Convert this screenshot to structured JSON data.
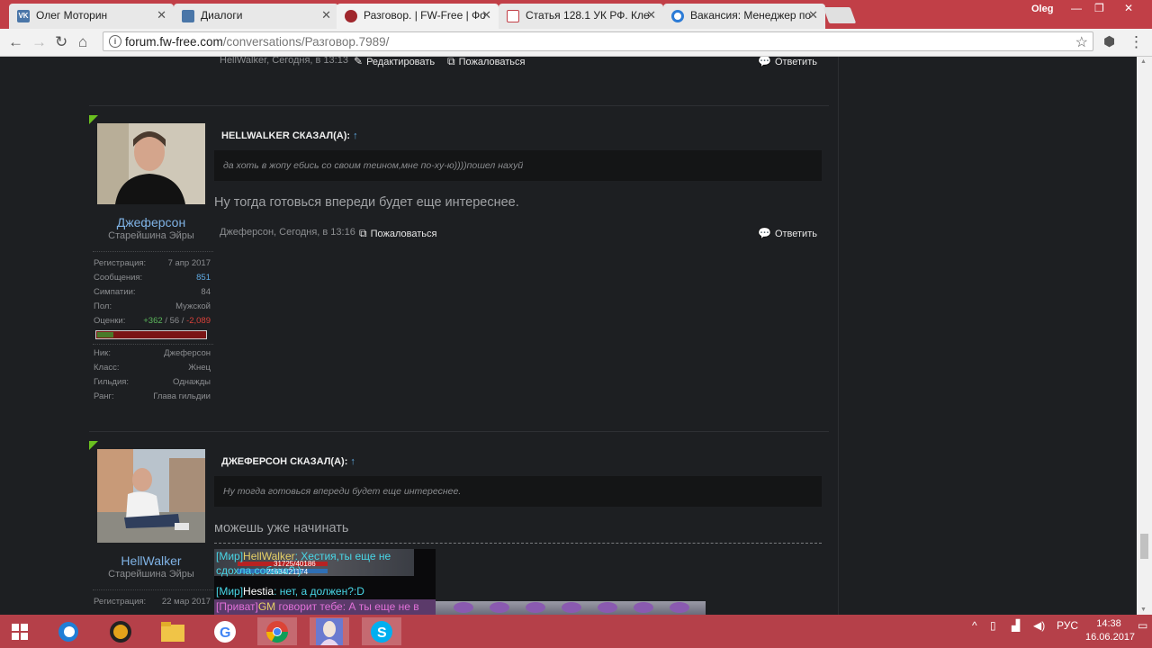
{
  "browser": {
    "tabs": [
      {
        "title": "Олег Моторин",
        "icon": "vk-icon",
        "color": "#4a76a8"
      },
      {
        "title": "Диалоги",
        "icon": "chat-icon",
        "color": "#4a76a8"
      },
      {
        "title": "Разговор. | FW-Free | Фо",
        "icon": "fwfree-icon",
        "color": "#a0272d",
        "active": true
      },
      {
        "title": "Статья 128.1 УК РФ. Кле",
        "icon": "doc-icon",
        "color": "#c13f47"
      },
      {
        "title": "Вакансия: Менеджер по",
        "icon": "hh-icon",
        "color": "#2c7bd6"
      }
    ],
    "user": "Oleg",
    "url_host": "forum.fw-free.com",
    "url_path": "/conversations/Разговор.7989/"
  },
  "posts": [
    {
      "meta": "HellWalker, Сегодня, в 13:13",
      "edit_label": "Редактировать",
      "report_label": "Пожаловаться",
      "reply_label": "Ответить"
    },
    {
      "username": "Джеферсон",
      "usertitle": "Старейшина Эйры",
      "stats": [
        {
          "label": "Регистрация:",
          "value": "7 апр 2017"
        },
        {
          "label": "Сообщения:",
          "value": "851"
        },
        {
          "label": "Симпатии:",
          "value": "84"
        },
        {
          "label": "Пол:",
          "value": "Мужской"
        }
      ],
      "ratings_label": "Оценки:",
      "ratings": {
        "positive": "+362",
        "sep1": " / ",
        "neutral": "56",
        "sep2": " / ",
        "negative": "-2,089"
      },
      "rating_bar_positive_fraction": 0.15,
      "game_stats": [
        {
          "label": "Ник:",
          "value": "Джеферсон"
        },
        {
          "label": "Класс:",
          "value": "Жнец"
        },
        {
          "label": "Гильдия:",
          "value": "Однажды"
        },
        {
          "label": "Ранг:",
          "value": "Глава гильдии"
        }
      ],
      "quote_header": "HELLWALKER СКАЗАЛ(А):",
      "quote_arrow": "↑",
      "quote_text": "да хоть в жопу ебись со своим теином,мне по-ху-ю))))пошел нахуй",
      "message": "Ну тогда готовься впереди будет еще интереснее.",
      "meta": "Джеферсон, Сегодня, в 13:16",
      "report_label": "Пожаловаться",
      "reply_label": "Ответить"
    },
    {
      "username": "HellWalker",
      "usertitle": "Старейшина Эйры",
      "stats": [
        {
          "label": "Регистрация:",
          "value": "22 мар 2017"
        }
      ],
      "quote_header": "ДЖЕФЕРСОН СКАЗАЛ(А):",
      "quote_arrow": "↑",
      "quote_text": "Ну тогда готовься впереди будет еще интереснее.",
      "message": "можешь уже начинать",
      "game_screenshot": {
        "line1_tag": "[Мир]",
        "line1_name": "HellWalker",
        "line1_text": ": Хестия,ты еще не",
        "line2_text": "сдохла,собака?:)",
        "hp": "31725/40186",
        "mp": "21634/21174",
        "line3_tag": "[Мир]",
        "line3_name": "Hestia",
        "line3_text": ": нет, а должен?:D",
        "line4_tag": "[Приват]",
        "line4_name": "GM",
        "line4_text": " говорит тебе: А ты еще не в"
      }
    }
  ],
  "taskbar": {
    "lang": "РУС",
    "time": "14:38",
    "date": "16.06.2017"
  }
}
